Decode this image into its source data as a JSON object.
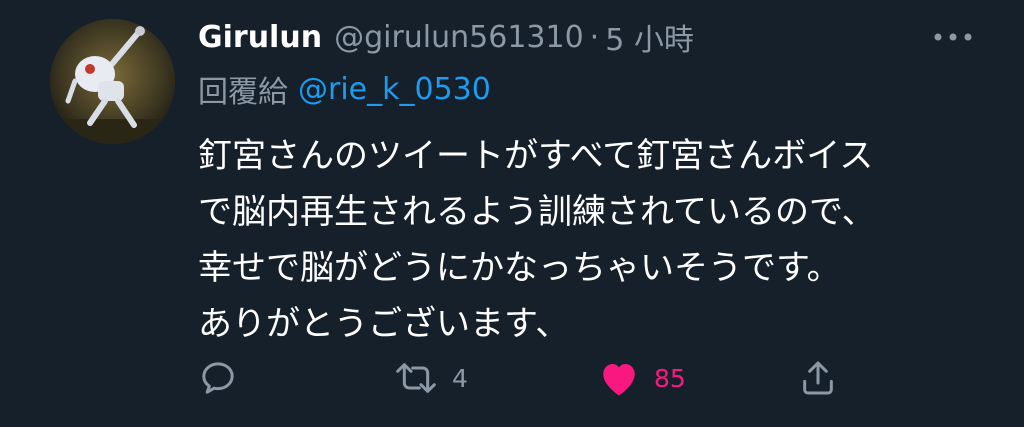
{
  "tweet": {
    "display_name": "Girulun",
    "handle": "@girulun561310",
    "separator": "·",
    "time": "5 小時",
    "reply_prefix": "回覆給",
    "reply_to": "@rie_k_0530",
    "text_lines": [
      "釘宮さんのツイートがすべて釘宮さんボイス",
      "で脳内再生されるよう訓練されているので、",
      "幸せで脳がどうにかなっちゃいそうです。",
      "ありがとうございます、"
    ]
  },
  "actions": {
    "retweet_count": "4",
    "like_count": "85"
  },
  "colors": {
    "background": "#15202b",
    "primary_text": "#ffffff",
    "secondary_text": "#8b98a5",
    "link": "#1d9bf0",
    "like": "#f91880"
  },
  "icons": {
    "avatar": "robot-avatar",
    "more": "more-options-icon",
    "reply": "reply-icon",
    "retweet": "retweet-icon",
    "like": "heart-icon",
    "share": "share-icon"
  }
}
